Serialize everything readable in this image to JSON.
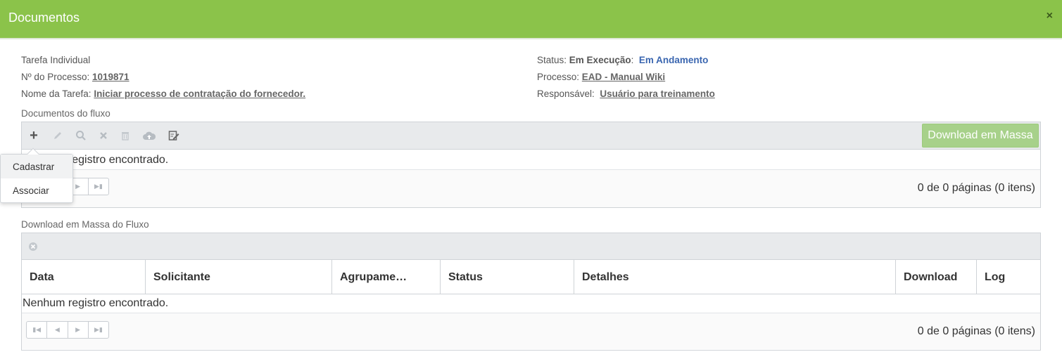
{
  "header": {
    "title": "Documentos",
    "close": "×"
  },
  "task": {
    "type": "Tarefa Individual",
    "process_no_label": "Nº do Processo:",
    "process_no": "1019871",
    "task_name_label": "Nome da Tarefa:",
    "task_name": "Iniciar processo de contratação do fornecedor."
  },
  "status": {
    "status_label": "Status:",
    "status_value": "Em Execução",
    "status_sub": "Em Andamento",
    "process_label": "Processo:",
    "process_value": "EAD - Manual Wiki",
    "owner_label": "Responsável:",
    "owner_value": "Usuário para treinamento"
  },
  "flow_docs": {
    "label": "Documentos do fluxo",
    "toolbar_icons": [
      "add-icon",
      "edit-icon",
      "search-icon",
      "delete-icon",
      "trash-icon",
      "cloud-upload-icon",
      "sign-icon"
    ],
    "mass_download_button": "Download em Massa",
    "empty_text": "Nenhum registro encontrado.",
    "pager_info": "0 de 0 páginas (0 itens)"
  },
  "popup": {
    "items": [
      "Cadastrar",
      "Associar"
    ]
  },
  "mass_download": {
    "label": "Download em Massa do Fluxo",
    "columns": [
      "Data",
      "Solicitante",
      "Agrupame…",
      "Status",
      "Detalhes",
      "Download",
      "Log"
    ],
    "empty_text": "Nenhum registro encontrado.",
    "pager_info": "0 de 0 páginas (0 itens)"
  }
}
